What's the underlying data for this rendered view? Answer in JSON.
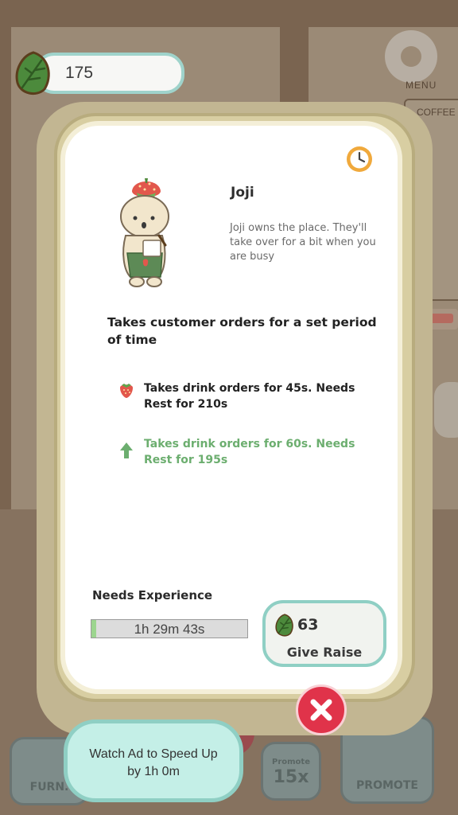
{
  "currency": {
    "leaves": "175"
  },
  "background": {
    "menu_label": "MENU",
    "board_label": "COFFEE",
    "bottom_bar": {
      "furniture_label": "FURN.",
      "promote_small_label": "Promote",
      "promote_multiplier": "15x",
      "promote_label": "PROMOTE"
    }
  },
  "staff": {
    "name": "Joji",
    "description": "Joji owns the place. They'll take over for a bit when you are busy",
    "ability": "Takes customer orders for a set period of time",
    "current_level": "Takes drink orders for 45s. Needs Rest for 210s",
    "next_level": "Takes drink orders for 60s. Needs Rest for 195s"
  },
  "experience": {
    "label": "Needs Experience",
    "timer": "1h 29m 43s",
    "progress": 0.03
  },
  "raise": {
    "cost": "63",
    "label": "Give Raise"
  },
  "ad": {
    "line1": "Watch Ad to Speed Up",
    "line2": "by 1h 0m"
  },
  "colors": {
    "accent_teal": "#8fcfc4",
    "next_level_green": "#6cae6f",
    "close_red": "#e0334a",
    "panel_frame": "#d8cea2"
  }
}
